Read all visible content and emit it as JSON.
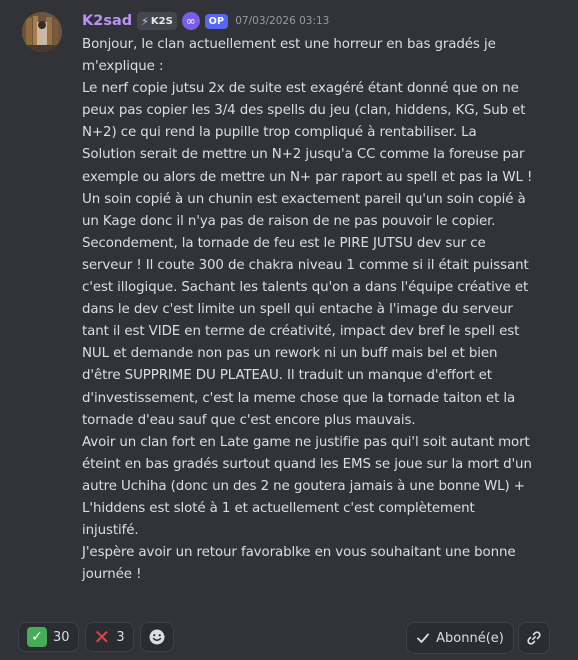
{
  "author": {
    "name": "K2sad",
    "clan_tag": "K2S",
    "op_badge": "OP",
    "timestamp": "07/03/2026 03:13"
  },
  "message": {
    "paragraphs": [
      "Bonjour, le clan actuellement est une horreur en bas gradés je m'explique :",
      "Le nerf copie jutsu 2x de suite  est exagéré étant donné que on ne peux pas copier les 3/4 des spells du jeu (clan, hiddens, KG, Sub et N+2) ce qui rend la pupille trop compliqué à rentabiliser. La Solution serait de mettre un N+2 jusqu'a CC comme la foreuse par exemple ou alors de mettre un N+ par raport au spell et pas la WL ! Un soin  copié à un chunin est exactement pareil qu'un soin copié à un Kage donc il n'ya pas de raison de ne pas pouvoir le copier.",
      "Secondement, la tornade de feu est le PIRE JUTSU dev sur ce serveur ! Il coute 300 de chakra niveau 1 comme si il était puissant c'est illogique. Sachant les talents qu'on a dans l'équipe créative et dans le dev c'est limite un spell qui entache à l'image du serveur tant il est VIDE en terme de créativité, impact dev bref le spell est NUL et demande non pas un rework ni un buff mais bel et bien d'être SUPPRIME DU PLATEAU. Il traduit un manque d'effort et d'investissement, c'est la meme chose que la tornade taiton et la tornade d'eau sauf que c'est encore plus mauvais.",
      "Avoir un clan fort en Late game ne justifie pas qui'l soit autant mort éteint en bas gradés surtout quand les EMS se joue sur la mort d'un autre Uchiha (donc un des 2 ne goutera jamais à une bonne WL) + L'hiddens est sloté à 1 et actuellement c'est complètement injustifé.",
      "J'espère avoir un retour favorablke en vous souhaitant une bonne journée !"
    ]
  },
  "reactions": [
    {
      "icon": "check-mark-icon",
      "count": "30"
    },
    {
      "icon": "cross-mark-icon",
      "count": "3"
    }
  ],
  "actions": {
    "follow_label": "Abonné(e)"
  },
  "colors": {
    "background": "#323339",
    "username": "#b794f4",
    "op_badge": "#5865f2",
    "check": "#44ad55",
    "cross": "#e04545"
  }
}
